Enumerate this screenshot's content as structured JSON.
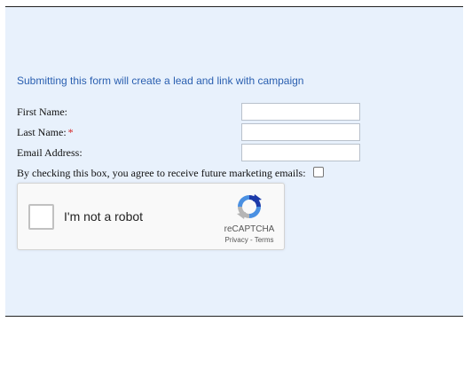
{
  "form": {
    "intro": "Submitting this form will create a lead and link with campaign",
    "fields": [
      {
        "label": "First Name:",
        "required": false,
        "value": ""
      },
      {
        "label": "Last Name:",
        "required": true,
        "value": ""
      },
      {
        "label": "Email Address:",
        "required": false,
        "value": ""
      }
    ],
    "required_marker": "*",
    "optin_label": "By checking this box, you agree to receive future marketing emails:"
  },
  "captcha": {
    "label": "I'm not a robot",
    "brand": "reCAPTCHA",
    "privacy": "Privacy",
    "separator": " - ",
    "terms": "Terms"
  },
  "colors": {
    "panel_bg": "#e8f1fc",
    "intro_text": "#2a5fb0",
    "required": "#d42020"
  },
  "icons": {
    "recaptcha_logo": "recaptcha-logo-icon"
  }
}
